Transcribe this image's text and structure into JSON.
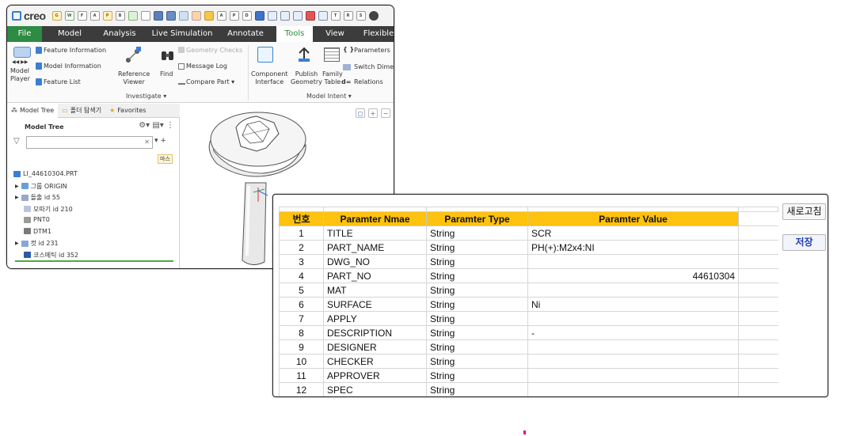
{
  "creo": {
    "logo_text": "creo",
    "tabs": [
      "File",
      "Model",
      "Analysis",
      "Live Simulation",
      "Annotate",
      "Tools",
      "View",
      "Flexible"
    ],
    "active_tab": "Tools",
    "ribbon": {
      "model_player": "Model\nPlayer",
      "feature_information": "Feature Information",
      "model_information": "Model Information",
      "feature_list": "Feature List",
      "reference_viewer": "Reference\nViewer",
      "find": "Find",
      "geometry_checks": "Geometry Checks",
      "message_log": "Message Log",
      "compare_part": "Compare Part",
      "investigate_group": "Investigate",
      "component_interface": "Component\nInterface",
      "publish_geometry": "Publish\nGeometry",
      "family_table": "Family\nTable",
      "parameters": "Parameters",
      "switch_dimensions": "Switch Dimen",
      "relations": "Relations",
      "model_intent_group": "Model Intent"
    },
    "tree_tabs": [
      "Model Tree",
      "폴더 탐색기",
      "Favorites"
    ],
    "tree_title": "Model Tree",
    "mask_label": "마스",
    "tree_items": [
      {
        "label": "LI_44610304.PRT",
        "color": "#3b7fd4",
        "indent": 0
      },
      {
        "label": "그룹 ORIGIN",
        "color": "#6a9ed8",
        "indent": 1
      },
      {
        "label": "돌출 id 55",
        "color": "#9aa8c8",
        "indent": 1
      },
      {
        "label": "모따기 id 210",
        "color": "#b9c4dd",
        "indent": 2
      },
      {
        "label": "PNT0",
        "color": "#9a9a9a",
        "indent": 2
      },
      {
        "label": "DTM1",
        "color": "#7a7a7a",
        "indent": 2
      },
      {
        "label": "컷 id 231",
        "color": "#86a8d8",
        "indent": 1
      },
      {
        "label": "코스메틱 id 352",
        "color": "#2d5aa8",
        "indent": 2
      }
    ]
  },
  "param_window": {
    "headers": [
      "번호",
      "Paramter Nmae",
      "Paramter Type",
      "Paramter Value"
    ],
    "rows": [
      {
        "no": "1",
        "name": "TITLE",
        "type": "String",
        "value": "SCR",
        "align": "left"
      },
      {
        "no": "2",
        "name": "PART_NAME",
        "type": "String",
        "value": "PH(+):M2x4:NI",
        "align": "left"
      },
      {
        "no": "3",
        "name": "DWG_NO",
        "type": "String",
        "value": "",
        "align": "left"
      },
      {
        "no": "4",
        "name": "PART_NO",
        "type": "String",
        "value": "44610304",
        "align": "right"
      },
      {
        "no": "5",
        "name": "MAT",
        "type": "String",
        "value": "",
        "align": "left"
      },
      {
        "no": "6",
        "name": "SURFACE",
        "type": "String",
        "value": "Ni",
        "align": "left"
      },
      {
        "no": "7",
        "name": "APPLY",
        "type": "String",
        "value": "",
        "align": "left"
      },
      {
        "no": "8",
        "name": "DESCRIPTION",
        "type": "String",
        "value": "-",
        "align": "left"
      },
      {
        "no": "9",
        "name": "DESIGNER",
        "type": "String",
        "value": "",
        "align": "left"
      },
      {
        "no": "10",
        "name": "CHECKER",
        "type": "String",
        "value": "",
        "align": "left"
      },
      {
        "no": "11",
        "name": "APPROVER",
        "type": "String",
        "value": "",
        "align": "left"
      },
      {
        "no": "12",
        "name": "SPEC",
        "type": "String",
        "value": "",
        "align": "left"
      }
    ],
    "refresh_label": "새로고침",
    "save_label": "저장",
    "header_color": "#ffc20e"
  }
}
